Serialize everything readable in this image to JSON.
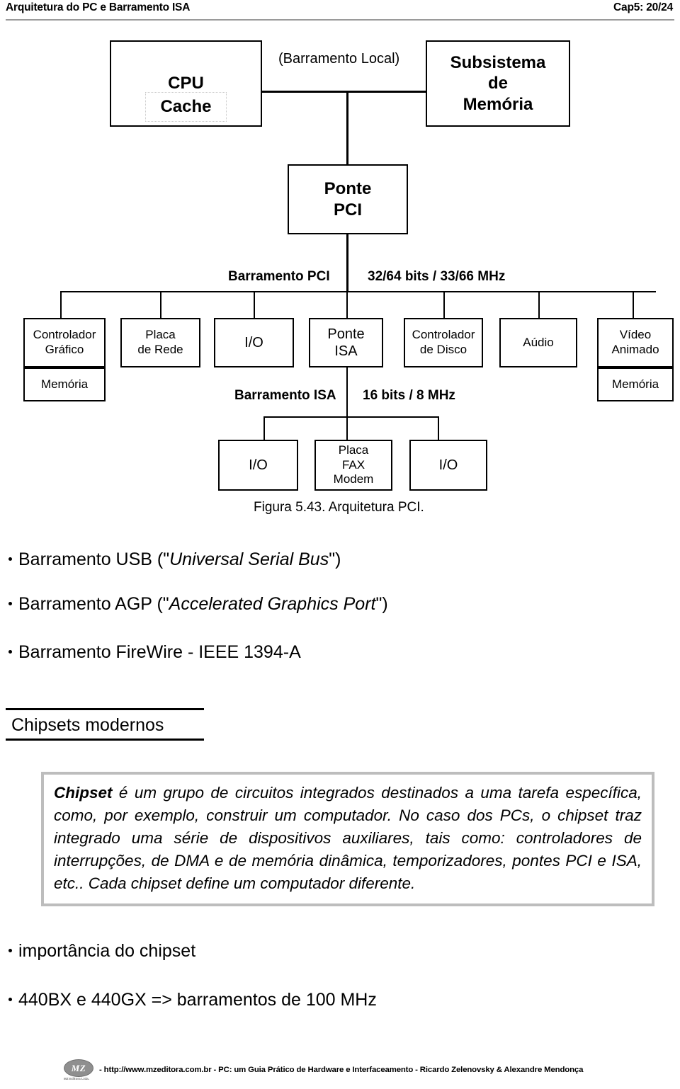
{
  "header": {
    "title": "Arquitetura do PC e Barramento ISA",
    "page_ref": "Cap5: 20/24"
  },
  "diagram": {
    "cpu": {
      "title": "CPU",
      "cache": "Cache"
    },
    "local_bus_label": "(Barramento Local)",
    "memory_subsystem": {
      "line1": "Subsistema",
      "line2": "de",
      "line3": "Memória"
    },
    "pci_bridge": {
      "line1": "Ponte",
      "line2": "PCI"
    },
    "pci_bus": {
      "name": "Barramento  PCI",
      "spec": "32/64  bits  / 33/66 MHz"
    },
    "pci_devices": [
      {
        "line1": "Controlador",
        "line2": "Gráfico",
        "sub": "Memória"
      },
      {
        "line1": "Placa",
        "line2": "de Rede",
        "sub": null
      },
      {
        "line1": "I/O",
        "line2": null,
        "sub": null
      },
      {
        "line1": "Ponte",
        "line2": "ISA",
        "sub": null
      },
      {
        "line1": "Controlador",
        "line2": "de Disco",
        "sub": null
      },
      {
        "line1": "Aúdio",
        "line2": null,
        "sub": null
      },
      {
        "line1": "Vídeo",
        "line2": "Animado",
        "sub": "Memória"
      }
    ],
    "isa_bus": {
      "name": "Barramento  ISA",
      "spec": "16 bits  / 8 MHz"
    },
    "isa_devices": [
      {
        "line1": "I/O",
        "line2": null,
        "line3": null
      },
      {
        "line1": "Placa",
        "line2": "FAX",
        "line3": "Modem"
      },
      {
        "line1": "I/O",
        "line2": null,
        "line3": null
      }
    ],
    "caption": "Figura 5.43.  Arquitetura PCI."
  },
  "bullets_top": [
    {
      "plain1": "Barramento USB (\"",
      "italic": "Universal Serial Bus",
      "plain2": "\")"
    },
    {
      "plain1": "Barramento AGP (\"",
      "italic": "Accelerated Graphics Port",
      "plain2": "\")"
    },
    {
      "plain1": "Barramento FireWire - IEEE 1394-A",
      "italic": "",
      "plain2": ""
    }
  ],
  "section": {
    "title": "Chipsets modernos"
  },
  "quote": {
    "lead": "Chipset",
    "body": " é um grupo de circuitos integrados destinados a uma tarefa específica, como, por exemplo, construir um computador. No caso dos PCs, o chipset traz integrado uma série de dispositivos auxiliares, tais como: controladores de interrupções, de DMA e de memória dinâmica, temporizadores, pontes PCI e ISA, etc.. Cada chipset define um computador diferente.",
    "border_color": "#bdbdbd"
  },
  "bullets_bottom": [
    {
      "text": "importância do chipset"
    },
    {
      "text": "440BX e 440GX => barramentos de 100 MHz"
    }
  ],
  "footer": {
    "logo_mark": "MZ",
    "logo_sub": "MZ Editora Ltda.",
    "text": "- http://www.mzeditora.com.br - PC: um Guia Prático de Hardware e Interfaceamento - Ricardo Zelenovsky & Alexandre Mendonça"
  }
}
